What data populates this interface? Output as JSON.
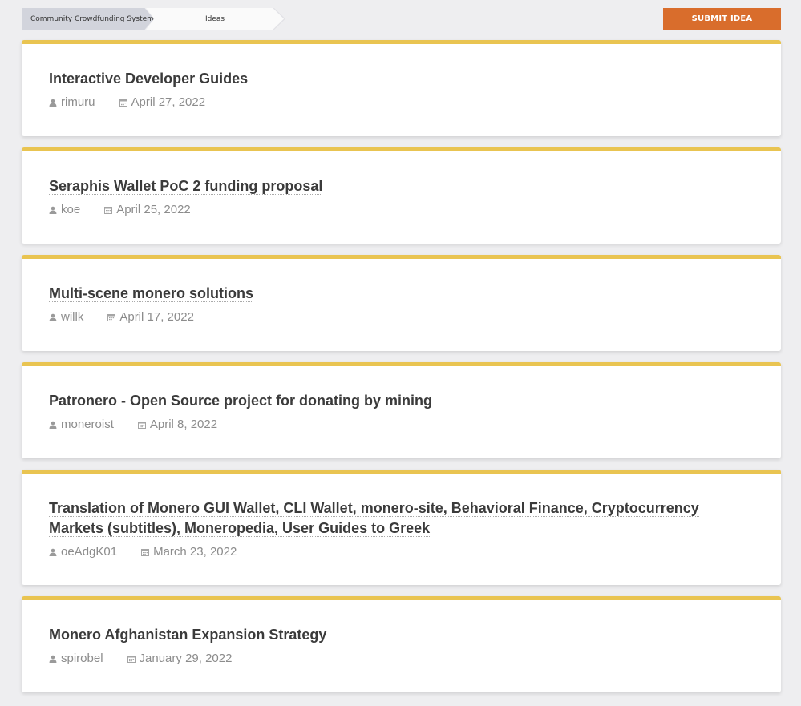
{
  "breadcrumb": {
    "root": "Community Crowdfunding System",
    "current": "Ideas"
  },
  "actions": {
    "submit_label": "SUBMIT IDEA"
  },
  "colors": {
    "accent": "#d96d2c",
    "card_top_border": "#e9c451"
  },
  "ideas": [
    {
      "title": "Interactive Developer Guides",
      "author": "rimuru",
      "date": "April 27, 2022"
    },
    {
      "title": "Seraphis Wallet PoC 2 funding proposal",
      "author": "koe",
      "date": "April 25, 2022"
    },
    {
      "title": "Multi-scene monero solutions",
      "author": "willk",
      "date": "April 17, 2022"
    },
    {
      "title": "Patronero - Open Source project for donating by mining",
      "author": "moneroist",
      "date": "April 8, 2022"
    },
    {
      "title": "Translation of Monero GUI Wallet, CLI Wallet, monero-site, Behavioral Finance, Cryptocurrency Markets (subtitles), Moneropedia, User Guides to Greek",
      "author": "oeAdgK01",
      "date": "March 23, 2022"
    },
    {
      "title": "Monero Afghanistan Expansion Strategy",
      "author": "spirobel",
      "date": "January 29, 2022"
    }
  ],
  "icons": {
    "author": "user-icon",
    "date": "calendar-icon"
  }
}
